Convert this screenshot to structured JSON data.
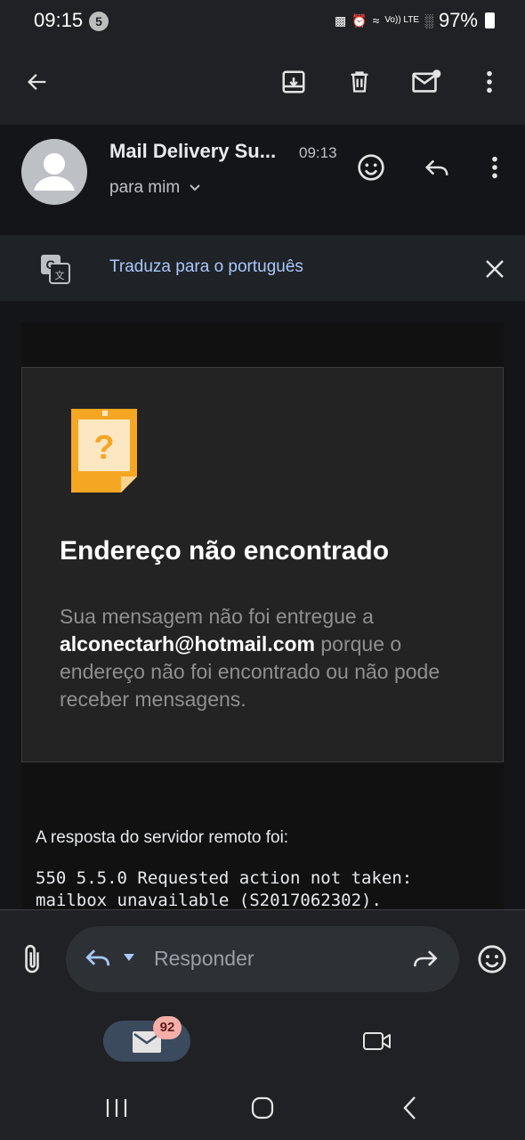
{
  "status_bar": {
    "time": "09:15",
    "notification_count": "5",
    "network_label": "Vo)) LTE",
    "battery": "97%"
  },
  "toolbar": {
    "back": "back-arrow-icon",
    "archive": "archive-icon",
    "delete": "trash-icon",
    "mark_unread": "mark-unread-icon",
    "more": "more-vert-icon"
  },
  "message": {
    "sender": "Mail Delivery Su...",
    "time": "09:13",
    "to_label": "para mim"
  },
  "translate": {
    "text": "Traduza para o português"
  },
  "bounce": {
    "title": "Endereço não encontrado",
    "text_before": "Sua mensagem não foi entregue a",
    "address": "alconectarh@hotmail.com",
    "text_after": "porque o endereço não foi encontrado ou não pode receber mensagens.",
    "server_label": "A resposta do servidor remoto foi:",
    "server_code": "550 5.5.0 Requested action not taken:\nmailbox unavailable (S2017062302)."
  },
  "reply": {
    "placeholder": "Responder"
  },
  "bottom_nav": {
    "mail_badge": "92"
  },
  "colors": {
    "accent": "#a8c7fa",
    "sticky_note": "#f5a623",
    "badge": "#f6aea9"
  }
}
